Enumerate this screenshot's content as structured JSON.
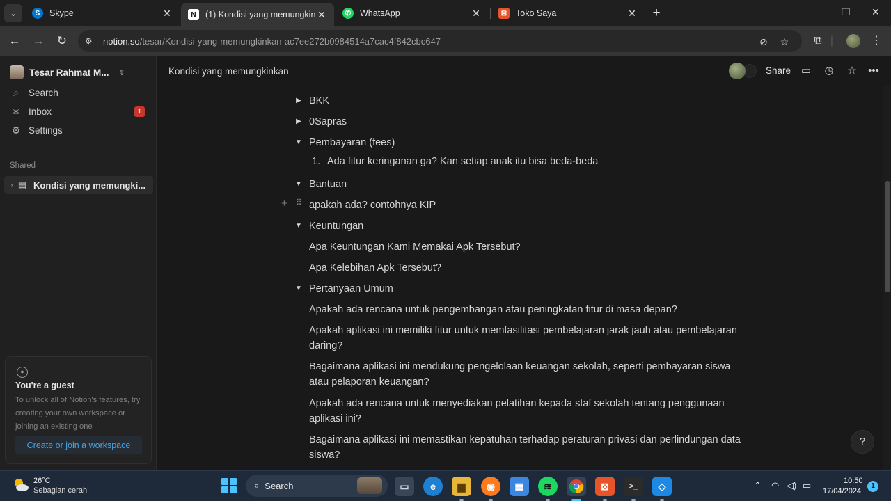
{
  "browser": {
    "tabs": [
      {
        "title": "Skype",
        "favicon": "skype-icon",
        "color": "#0078d4",
        "glyph": "S"
      },
      {
        "title": "(1) Kondisi yang memungkinkan",
        "favicon": "notion-icon",
        "color": "#ffffff",
        "glyph": "N"
      },
      {
        "title": "WhatsApp",
        "favicon": "whatsapp-icon",
        "color": "#25d366",
        "glyph": "✆"
      },
      {
        "title": "Toko Saya",
        "favicon": "store-icon",
        "color": "#e8542a",
        "glyph": "⊠"
      }
    ],
    "url_host": "notion.so",
    "url_path": "/tesar/Kondisi-yang-memungkinkan-ac7ee272b0984514a7cac4f842cbc647"
  },
  "sidebar": {
    "workspace": "Tesar Rahmat M...",
    "items": [
      {
        "label": "Search",
        "icon": "search-icon"
      },
      {
        "label": "Inbox",
        "icon": "inbox-icon",
        "badge": "1"
      },
      {
        "label": "Settings",
        "icon": "gear-icon"
      }
    ],
    "section_label": "Shared",
    "shared_page": "Kondisi yang memungki...",
    "guest": {
      "title": "You're a guest",
      "text": "To unlock all of Notion's features, try creating your own workspace or joining an existing one",
      "button": "Create or join a workspace"
    }
  },
  "topbar": {
    "breadcrumb": "Kondisi yang memungkinkan",
    "share": "Share"
  },
  "content": {
    "toggles": [
      {
        "label": "BKK",
        "state": "collapsed"
      },
      {
        "label": "0Sapras",
        "state": "collapsed"
      },
      {
        "label": "Pembayaran (fees)",
        "state": "expanded"
      },
      {
        "label": "Bantuan",
        "state": "expanded"
      },
      {
        "label": "Keuntungan",
        "state": "expanded"
      },
      {
        "label": "Pertanyaan Umum",
        "state": "expanded"
      }
    ],
    "numbered_item": {
      "num": "1.",
      "text": "Ada fitur keringanan ga? Kan setiap anak itu bisa beda-beda"
    },
    "bantuan_line": "apakah ada? contohnya KIP",
    "keuntungan_lines": [
      "Apa Keuntungan Kami Memakai Apk Tersebut?",
      "Apa Kelebihan Apk Tersebut?"
    ],
    "umum_lines": [
      "Apakah ada rencana untuk pengembangan atau peningkatan fitur di masa depan?",
      "Apakah aplikasi ini memiliki fitur untuk memfasilitasi pembelajaran jarak jauh atau pembelajaran daring?",
      "Bagaimana aplikasi ini mendukung pengelolaan keuangan sekolah, seperti pembayaran siswa atau pelaporan keuangan?",
      "Apakah ada rencana untuk menyediakan pelatihan kepada staf sekolah tentang penggunaan aplikasi ini?",
      "Bagaimana aplikasi ini memastikan kepatuhan terhadap peraturan privasi dan perlindungan data siswa?"
    ],
    "help": "?"
  },
  "taskbar": {
    "temp": "26°C",
    "weather": "Sebagian cerah",
    "search": "Search",
    "time": "10:50",
    "date": "17/04/2024",
    "notifications": "1"
  }
}
